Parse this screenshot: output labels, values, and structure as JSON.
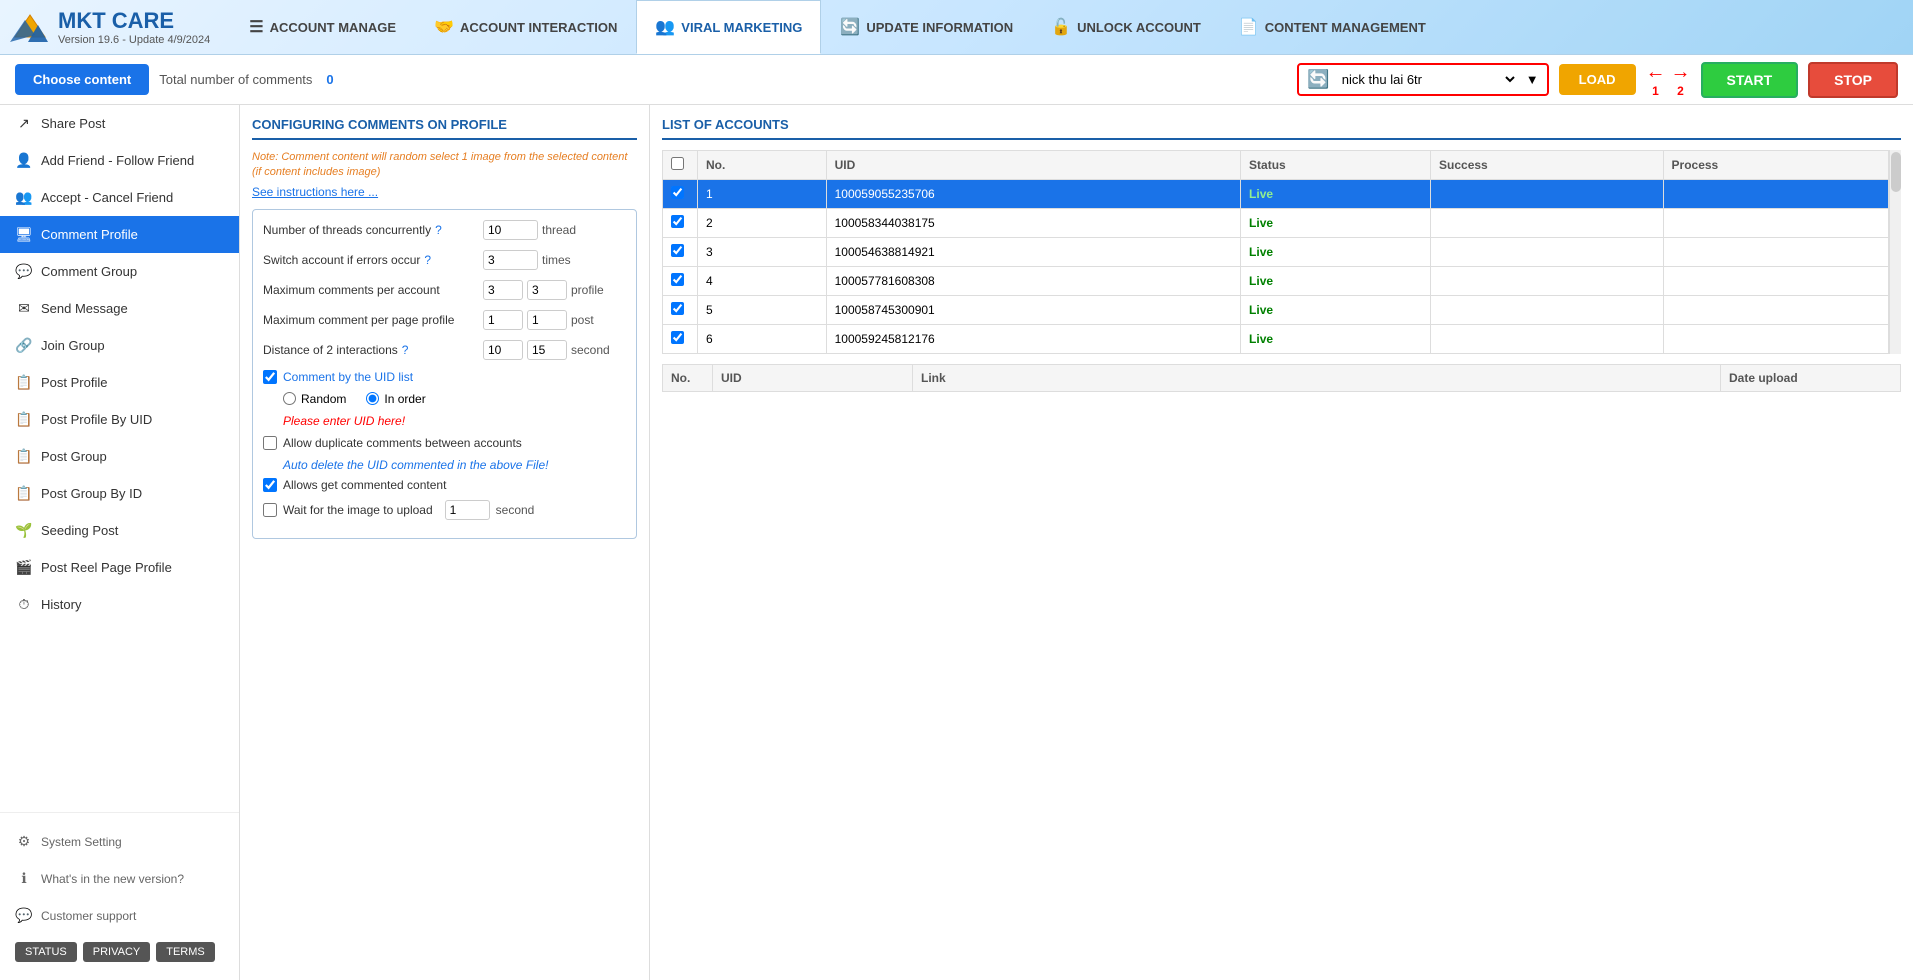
{
  "app": {
    "name": "MKT CARE",
    "version": "Version  19.6  -  Update  4/9/2024"
  },
  "nav": {
    "tabs": [
      {
        "id": "account-manage",
        "label": "ACCOUNT MANAGE",
        "icon": "☰",
        "active": false
      },
      {
        "id": "account-interaction",
        "label": "ACCOUNT INTERACTION",
        "icon": "🤝",
        "active": false
      },
      {
        "id": "viral-marketing",
        "label": "VIRAL MARKETING",
        "icon": "👥",
        "active": true
      },
      {
        "id": "update-information",
        "label": "UPDATE INFORMATION",
        "icon": "🔄",
        "active": false
      },
      {
        "id": "unlock-account",
        "label": "UNLOCK ACCOUNT",
        "icon": "🔓",
        "active": false
      },
      {
        "id": "content-management",
        "label": "CONTENT MANAGEMENT",
        "icon": "📄",
        "active": false
      }
    ]
  },
  "toolbar": {
    "choose_content_label": "Choose content",
    "total_comments_label": "Total number of comments",
    "total_comments_value": "0",
    "content_value": "nick thu lai 6tr",
    "load_label": "LOAD",
    "start_label": "START",
    "stop_label": "STOP",
    "arrow1_label": "1",
    "arrow2_label": "2"
  },
  "sidebar": {
    "items": [
      {
        "id": "share-post",
        "label": "Share Post",
        "icon": "↗"
      },
      {
        "id": "add-friend",
        "label": "Add Friend - Follow Friend",
        "icon": "👤"
      },
      {
        "id": "accept-cancel",
        "label": "Accept - Cancel Friend",
        "icon": "👥"
      },
      {
        "id": "comment-profile",
        "label": "Comment Profile",
        "icon": "🖥",
        "active": true
      },
      {
        "id": "comment-group",
        "label": "Comment Group",
        "icon": "💬"
      },
      {
        "id": "send-message",
        "label": "Send Message",
        "icon": "✉"
      },
      {
        "id": "join-group",
        "label": "Join Group",
        "icon": "🔗"
      },
      {
        "id": "post-profile",
        "label": "Post Profile",
        "icon": "📋"
      },
      {
        "id": "post-profile-uid",
        "label": "Post Profile By UID",
        "icon": "📋"
      },
      {
        "id": "post-group",
        "label": "Post Group",
        "icon": "📋"
      },
      {
        "id": "post-group-id",
        "label": "Post Group By ID",
        "icon": "📋"
      },
      {
        "id": "seeding-post",
        "label": "Seeding Post",
        "icon": "🌱"
      },
      {
        "id": "post-reel",
        "label": "Post Reel Page Profile",
        "icon": "🎬"
      },
      {
        "id": "history",
        "label": "History",
        "icon": "⏱"
      }
    ],
    "footer": {
      "system_setting": "System Setting",
      "whats_new": "What's in the new version?",
      "customer_support": "Customer support",
      "status_btn": "STATUS",
      "privacy_btn": "PRIVACY",
      "terms_btn": "TERMS"
    }
  },
  "left_panel": {
    "title": "CONFIGURING COMMENTS ON PROFILE",
    "note": "Note: Comment content will random select 1 image from the selected content (if content includes image)",
    "instruction_link": "See instructions here ...",
    "fields": {
      "threads_label": "Number of threads concurrently",
      "threads_value": "10",
      "threads_unit": "thread",
      "switch_label": "Switch account if errors occur",
      "switch_value": "3",
      "switch_unit": "times",
      "max_comments_label": "Maximum comments per account",
      "max_comments_val1": "3",
      "max_comments_val2": "3",
      "max_comments_unit": "profile",
      "max_per_page_label": "Maximum comment per page profile",
      "max_per_page_val1": "1",
      "max_per_page_val2": "1",
      "max_per_page_unit": "post",
      "distance_label": "Distance of 2 interactions",
      "distance_val1": "10",
      "distance_val2": "15",
      "distance_unit": "second"
    },
    "checkboxes": {
      "comment_by_uid": "Comment by the UID list",
      "random_label": "Random",
      "in_order_label": "In order",
      "uid_link": "Please enter UID here!",
      "allow_duplicate": "Allow duplicate comments between accounts",
      "auto_delete_link": "Auto delete the UID commented in the above File!",
      "allows_get": "Allows get commented content",
      "wait_image": "Wait for the image to upload",
      "wait_value": "1",
      "wait_unit": "second"
    }
  },
  "right_panel": {
    "title": "LIST OF ACCOUNTS",
    "columns": [
      "No.",
      "UID",
      "Status",
      "Success",
      "Process"
    ],
    "accounts": [
      {
        "no": 1,
        "uid": "100059055235706",
        "status": "Live",
        "success": "",
        "process": "",
        "selected": true
      },
      {
        "no": 2,
        "uid": "100058344038175",
        "status": "Live",
        "success": "",
        "process": "",
        "selected": false
      },
      {
        "no": 3,
        "uid": "100054638814921",
        "status": "Live",
        "success": "",
        "process": "",
        "selected": false
      },
      {
        "no": 4,
        "uid": "100057781608308",
        "status": "Live",
        "success": "",
        "process": "",
        "selected": false
      },
      {
        "no": 5,
        "uid": "100058745300901",
        "status": "Live",
        "success": "",
        "process": "",
        "selected": false
      },
      {
        "no": 6,
        "uid": "100059245812176",
        "status": "Live",
        "success": "",
        "process": "",
        "selected": false
      }
    ],
    "bottom_columns": [
      "No.",
      "UID",
      "Link",
      "Date upload"
    ]
  }
}
